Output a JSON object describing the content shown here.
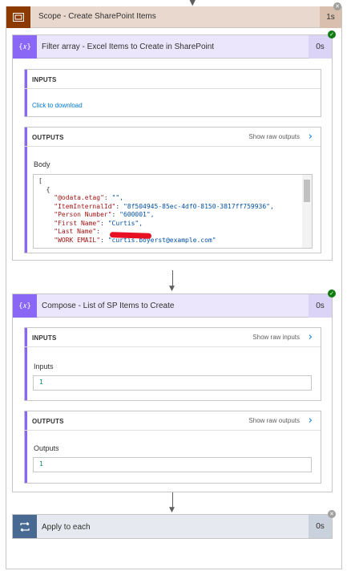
{
  "scope": {
    "title": "Scope - Create SharePoint Items",
    "duration": "1s"
  },
  "filter_action": {
    "title": "Filter array - Excel Items to Create in SharePoint",
    "duration": "0s",
    "inputs": {
      "label": "INPUTS",
      "download_link": "Click to download"
    },
    "outputs": {
      "label": "OUTPUTS",
      "raw_link": "Show raw outputs",
      "body_label": "Body",
      "code_lines": [
        {
          "text": "["
        },
        {
          "text": "  {"
        },
        {
          "key": "\"@odata.etag\"",
          "value": "\"\","
        },
        {
          "key": "\"ItemInternalId\"",
          "value": "\"8f504945-85ec-4df0-8150-3817ff759936\","
        },
        {
          "key": "\"Person Number\"",
          "value": "\"600001\","
        },
        {
          "key": "\"First Name\"",
          "value": "\"Curtis\","
        },
        {
          "key": "\"Last Name\"",
          "value": ""
        },
        {
          "key": "\"WORK EMAIL\"",
          "value": "\"curtis.boyerst@example.com\""
        }
      ]
    }
  },
  "compose_action": {
    "title": "Compose - List of SP Items to Create",
    "duration": "0s",
    "inputs": {
      "label": "INPUTS",
      "raw_link": "Show raw inputs",
      "field_label": "Inputs",
      "field_value": "1"
    },
    "outputs": {
      "label": "OUTPUTS",
      "raw_link": "Show raw outputs",
      "field_label": "Outputs",
      "field_value": "1"
    }
  },
  "apply_action": {
    "title": "Apply to each",
    "duration": "0s"
  },
  "colors": {
    "scope_accent": "#8c3a00",
    "action_accent": "#8a67f5",
    "apply_accent": "#486991",
    "success": "#107c10",
    "link": "#0078d4"
  }
}
